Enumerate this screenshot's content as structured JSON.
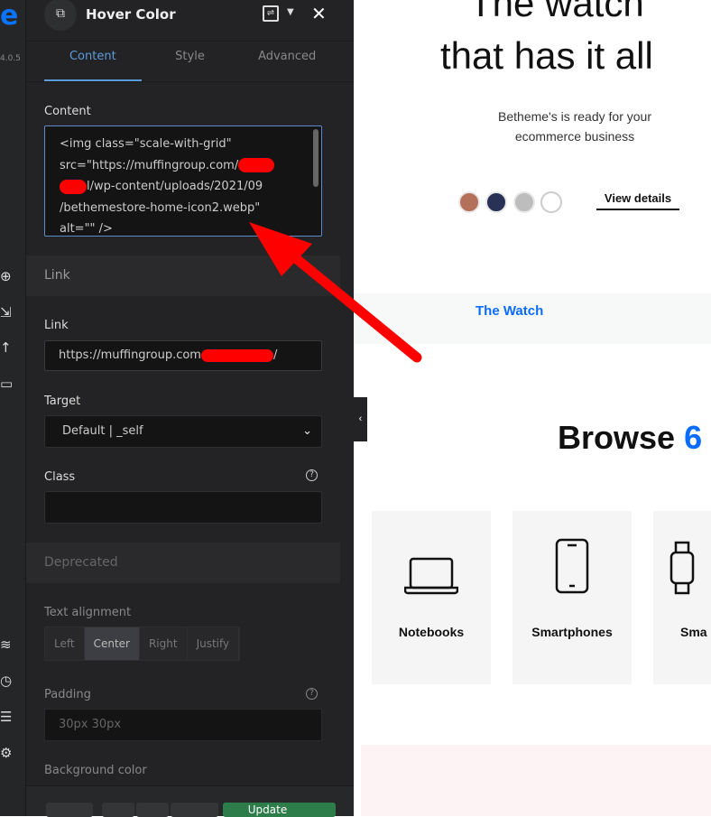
{
  "sidebar": {
    "version": "4.0.5"
  },
  "panel": {
    "title": "Hover Color",
    "tabs": [
      {
        "label": "Content"
      },
      {
        "label": "Style"
      },
      {
        "label": "Advanced"
      }
    ],
    "content_label": "Content",
    "content_value": [
      "<img class=\"scale-with-grid\"",
      "src=\"https://muffingroup.com/",
      "l/wp-content/uploads/2021/09",
      "/bethemestore-home-icon2.webp\"",
      "alt=\"\" />"
    ],
    "link_section": "Link",
    "link_label": "Link",
    "link_value": "https://muffingroup.com",
    "link_end": "/",
    "target_label": "Target",
    "target_value": "Default | _self",
    "class_label": "Class",
    "class_value": "",
    "deprecated_section": "Deprecated",
    "alignment_label": "Text alignment",
    "alignment_options": [
      "Left",
      "Center",
      "Right",
      "Justify"
    ],
    "alignment_selected": "Center",
    "padding_label": "Padding",
    "padding_placeholder": "30px 30px",
    "bg_label": "Background color",
    "update_label": "Update"
  },
  "preview": {
    "heading_line1": "The watch",
    "heading_line2": "that has it all",
    "subtitle_line1": "Betheme's is ready for your",
    "subtitle_line2": "ecommerce business",
    "swatches": [
      "#b5705a",
      "#2a3157",
      "#bdbdbd",
      "#ffffff"
    ],
    "view_details": "View details",
    "band_link": "The Watch",
    "browse_heading": "Browse",
    "browse_number": "6",
    "categories": [
      {
        "label": "Notebooks",
        "icon": "laptop-icon"
      },
      {
        "label": "Smartphones",
        "icon": "smartphone-icon"
      },
      {
        "label": "Sma",
        "icon": "smartwatch-icon"
      }
    ],
    "accent": "#0a6cff"
  }
}
